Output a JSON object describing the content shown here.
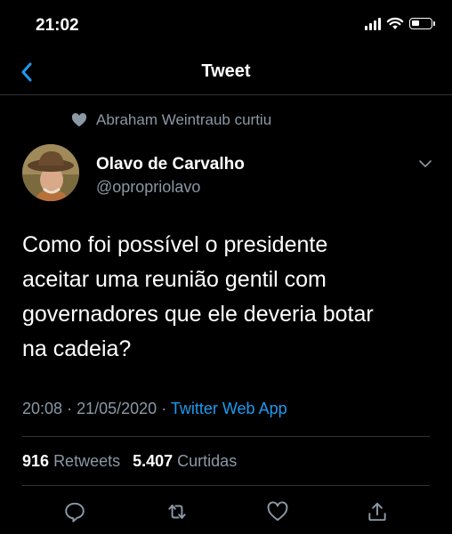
{
  "status_bar": {
    "time": "21:02"
  },
  "nav": {
    "title": "Tweet"
  },
  "social_context": {
    "text": "Abraham Weintraub curtiu"
  },
  "author": {
    "name": "Olavo de Carvalho",
    "handle": "@opropriolavo"
  },
  "tweet": {
    "lines": [
      "Como foi possível o presidente",
      "aceitar uma reunião gentil com",
      "governadores que ele deveria botar",
      "na cadeia?"
    ],
    "time": "20:08",
    "separator_1": "·",
    "date": "21/05/2020",
    "separator_2": "·",
    "source": "Twitter Web App"
  },
  "stats": {
    "retweets_count": "916",
    "retweets_label": "Retweets",
    "likes_count": "5.407",
    "likes_label": "Curtidas"
  },
  "colors": {
    "background": "#000000",
    "accent": "#1d9bf0",
    "muted": "#8b98a5",
    "divider": "#2f3336"
  },
  "icons": [
    "back-chevron-icon",
    "heart-icon",
    "chevron-down-icon",
    "reply-icon",
    "retweet-icon",
    "like-icon",
    "share-icon"
  ]
}
